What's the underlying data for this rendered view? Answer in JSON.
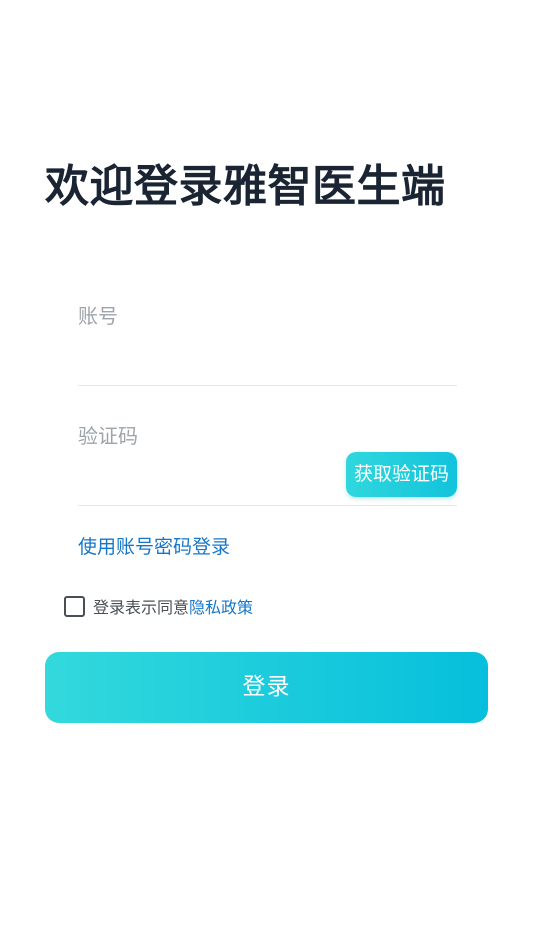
{
  "header": {
    "title": "欢迎登录雅智医生端"
  },
  "form": {
    "account": {
      "label": "账号",
      "value": ""
    },
    "code": {
      "label": "验证码",
      "value": "",
      "get_code_label": "获取验证码"
    },
    "switch_label": "使用账号密码登录",
    "agreement": {
      "checked": false,
      "text": "登录表示同意",
      "policy_label": "隐私政策"
    },
    "login_label": "登录"
  },
  "colors": {
    "accent_gradient_start": "#33d9dc",
    "accent_gradient_end": "#06bfdc",
    "link": "#1577c9",
    "title": "#1a2433"
  }
}
